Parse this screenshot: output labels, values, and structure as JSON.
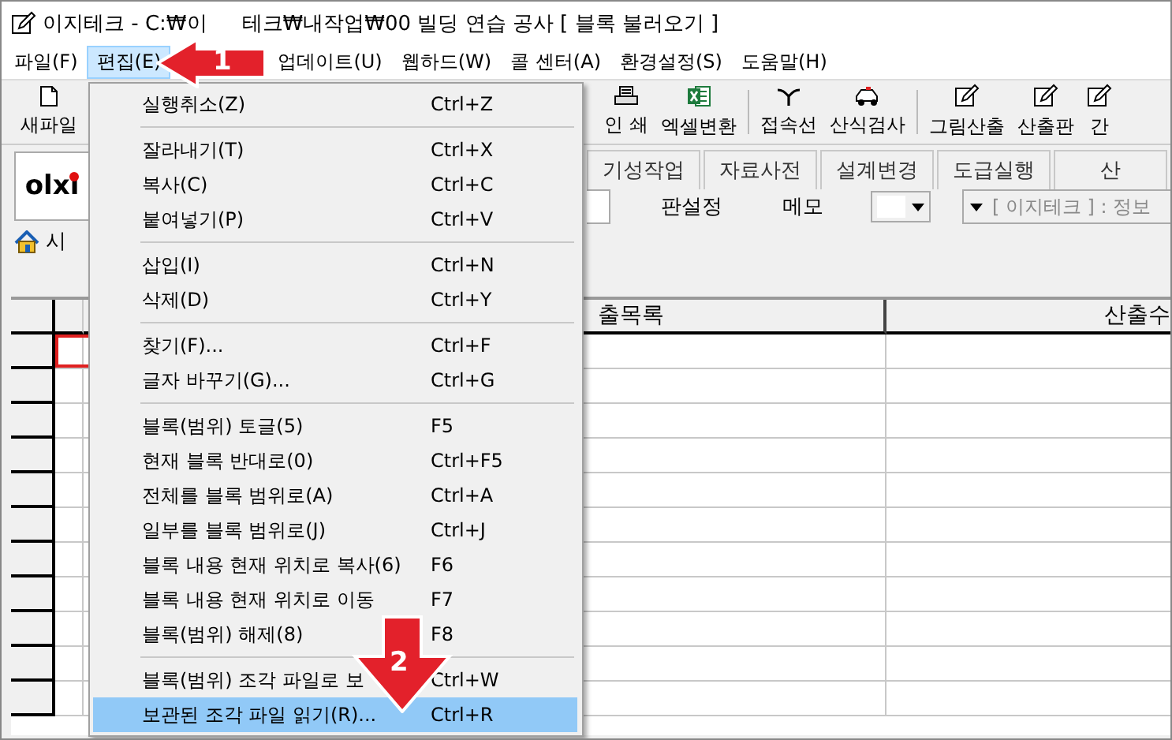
{
  "window": {
    "title_left": "이지테크 - C:₩이",
    "title_right": "테크₩내작업₩00 빌딩 연습 공사 [ 블록 불러오기 ]"
  },
  "menubar": [
    {
      "label": "파일(F)",
      "selected": false
    },
    {
      "label": "편집(E)",
      "selected": true
    },
    {
      "label": "업데이트(U)",
      "selected": false
    },
    {
      "label": "웹하드(W)",
      "selected": false
    },
    {
      "label": "콜 센터(A)",
      "selected": false
    },
    {
      "label": "환경설정(S)",
      "selected": false
    },
    {
      "label": "도움말(H)",
      "selected": false
    }
  ],
  "toolbar": [
    {
      "label": "새파일",
      "kind": "document"
    },
    {
      "label": "인 쇄",
      "kind": "printer"
    },
    {
      "label": "엑셀변환",
      "kind": "excel"
    },
    {
      "label": "접속선",
      "kind": "connector"
    },
    {
      "label": "산식검사",
      "kind": "car"
    },
    {
      "label": "그림산출",
      "kind": "edit"
    },
    {
      "label": "산출판",
      "kind": "edit"
    },
    {
      "label": "간",
      "kind": "edit"
    }
  ],
  "logo": {
    "text": "olxi"
  },
  "tabs": [
    "기성작업",
    "자료사전",
    "설계변경",
    "도급실행",
    "산"
  ],
  "options_bar": {
    "label_1": "판설정",
    "label_2": "메모",
    "dropdown_text": "[ 이지테크 ] : 정보"
  },
  "breadcrumb": "시",
  "table": {
    "columns": [
      "출목록",
      "산출수"
    ]
  },
  "edit_menu": {
    "groups": [
      [
        {
          "label": "실행취소(Z)",
          "shortcut": "Ctrl+Z",
          "selected": false
        }
      ],
      [
        {
          "label": "잘라내기(T)",
          "shortcut": "Ctrl+X",
          "selected": false
        },
        {
          "label": "복사(C)",
          "shortcut": "Ctrl+C",
          "selected": false
        },
        {
          "label": "붙여넣기(P)",
          "shortcut": "Ctrl+V",
          "selected": false
        }
      ],
      [
        {
          "label": "삽입(I)",
          "shortcut": "Ctrl+N",
          "selected": false
        },
        {
          "label": "삭제(D)",
          "shortcut": "Ctrl+Y",
          "selected": false
        }
      ],
      [
        {
          "label": "찾기(F)...",
          "shortcut": "Ctrl+F",
          "selected": false
        },
        {
          "label": "글자 바꾸기(G)...",
          "shortcut": "Ctrl+G",
          "selected": false
        }
      ],
      [
        {
          "label": "블록(범위) 토글(5)",
          "shortcut": "F5",
          "selected": false
        },
        {
          "label": "현재 블록 반대로(0)",
          "shortcut": "Ctrl+F5",
          "selected": false
        },
        {
          "label": "전체를 블록 범위로(A)",
          "shortcut": "Ctrl+A",
          "selected": false
        },
        {
          "label": "일부를 블록 범위로(J)",
          "shortcut": "Ctrl+J",
          "selected": false
        },
        {
          "label": "블록 내용 현재 위치로 복사(6)",
          "shortcut": "F6",
          "selected": false
        },
        {
          "label": "블록 내용 현재 위치로 이동",
          "shortcut": "F7",
          "selected": false
        },
        {
          "label": "블록(범위) 해제(8)",
          "shortcut": "F8",
          "selected": false
        }
      ],
      [
        {
          "label": "블록(범위) 조각 파일로 보",
          "shortcut": "Ctrl+W",
          "selected": false
        },
        {
          "label": "보관된 조각 파일 읽기(R)...",
          "shortcut": "Ctrl+R",
          "selected": true
        }
      ]
    ]
  },
  "annotations": [
    {
      "number": "1"
    },
    {
      "number": "2"
    }
  ]
}
